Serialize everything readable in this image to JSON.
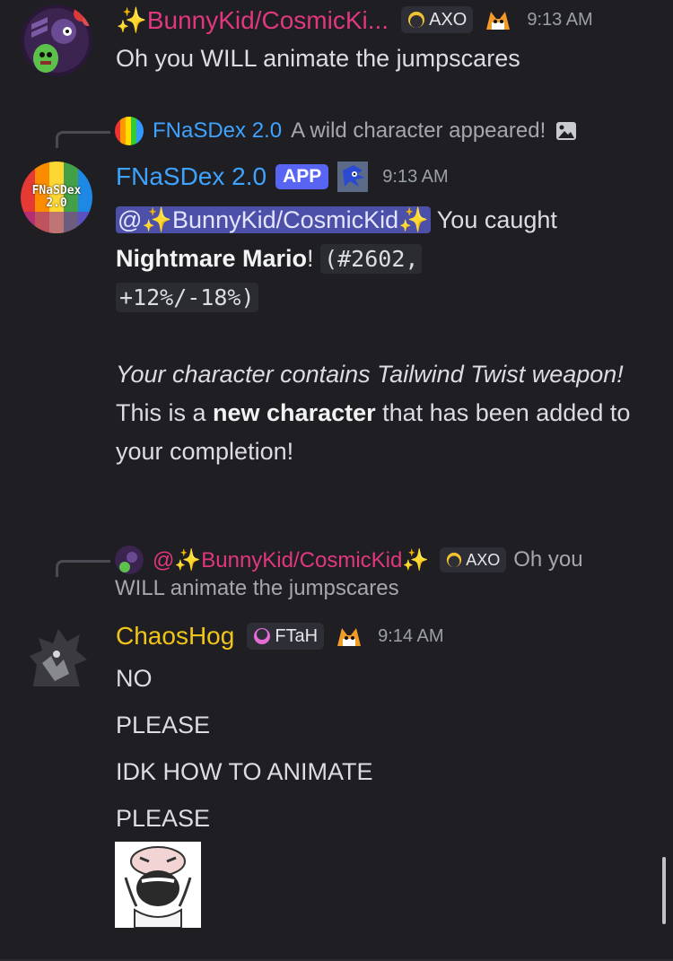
{
  "messages": {
    "first": {
      "username": "✨BunnyKid/CosmicKi...",
      "tag_label": "AXO",
      "time": "9:13 AM",
      "body": "Oh you WILL animate the jumpscares"
    },
    "bot": {
      "reply_author": "FNaSDex 2.0",
      "reply_preview": "A wild character appeared!",
      "username": "FNaSDex 2.0",
      "app_label": "APP",
      "time": "9:13 AM",
      "avatar_text_top": "FNaSDex",
      "avatar_text_bottom": "2.0",
      "mention": "@✨BunnyKid/CosmicKid✨",
      "caught_prefix": " You caught",
      "caught_name": "Nightmare Mario",
      "caught_after": "! ",
      "caught_code_1": "(#2602,",
      "caught_code_2": "+12%/-18%)",
      "weapon_line": "Your character contains Tailwind Twist weapon!",
      "new_pre": "This is a ",
      "new_bold": "new character",
      "new_post": " that has been added to your completion!"
    },
    "chaos": {
      "reply_author": "@✨BunnyKid/CosmicKid✨",
      "reply_tag": "AXO",
      "reply_preview_1": "Oh you",
      "reply_preview_2": "WILL animate the jumpscares",
      "username": "ChaosHog",
      "tag_label": "FTaH",
      "time": "9:14 AM",
      "lines": [
        "NO",
        "PLEASE",
        "IDK HOW TO ANIMATE",
        "PLEASE"
      ]
    }
  },
  "colors": {
    "bunny_name": "#e0377f",
    "bot_name": "#3ea3ff",
    "chaos_name": "#f0c419",
    "mention_bg": "#4c50a8",
    "app_badge": "#5865f2",
    "background": "#1f1f23"
  },
  "icons": {
    "axo_tag": "moon-badge-icon",
    "ftah_tag": "pink-moon-badge-icon",
    "tails": "tails-emoji-icon",
    "sonic": "sonic-emoji-icon",
    "image_attachment": "image-icon"
  }
}
